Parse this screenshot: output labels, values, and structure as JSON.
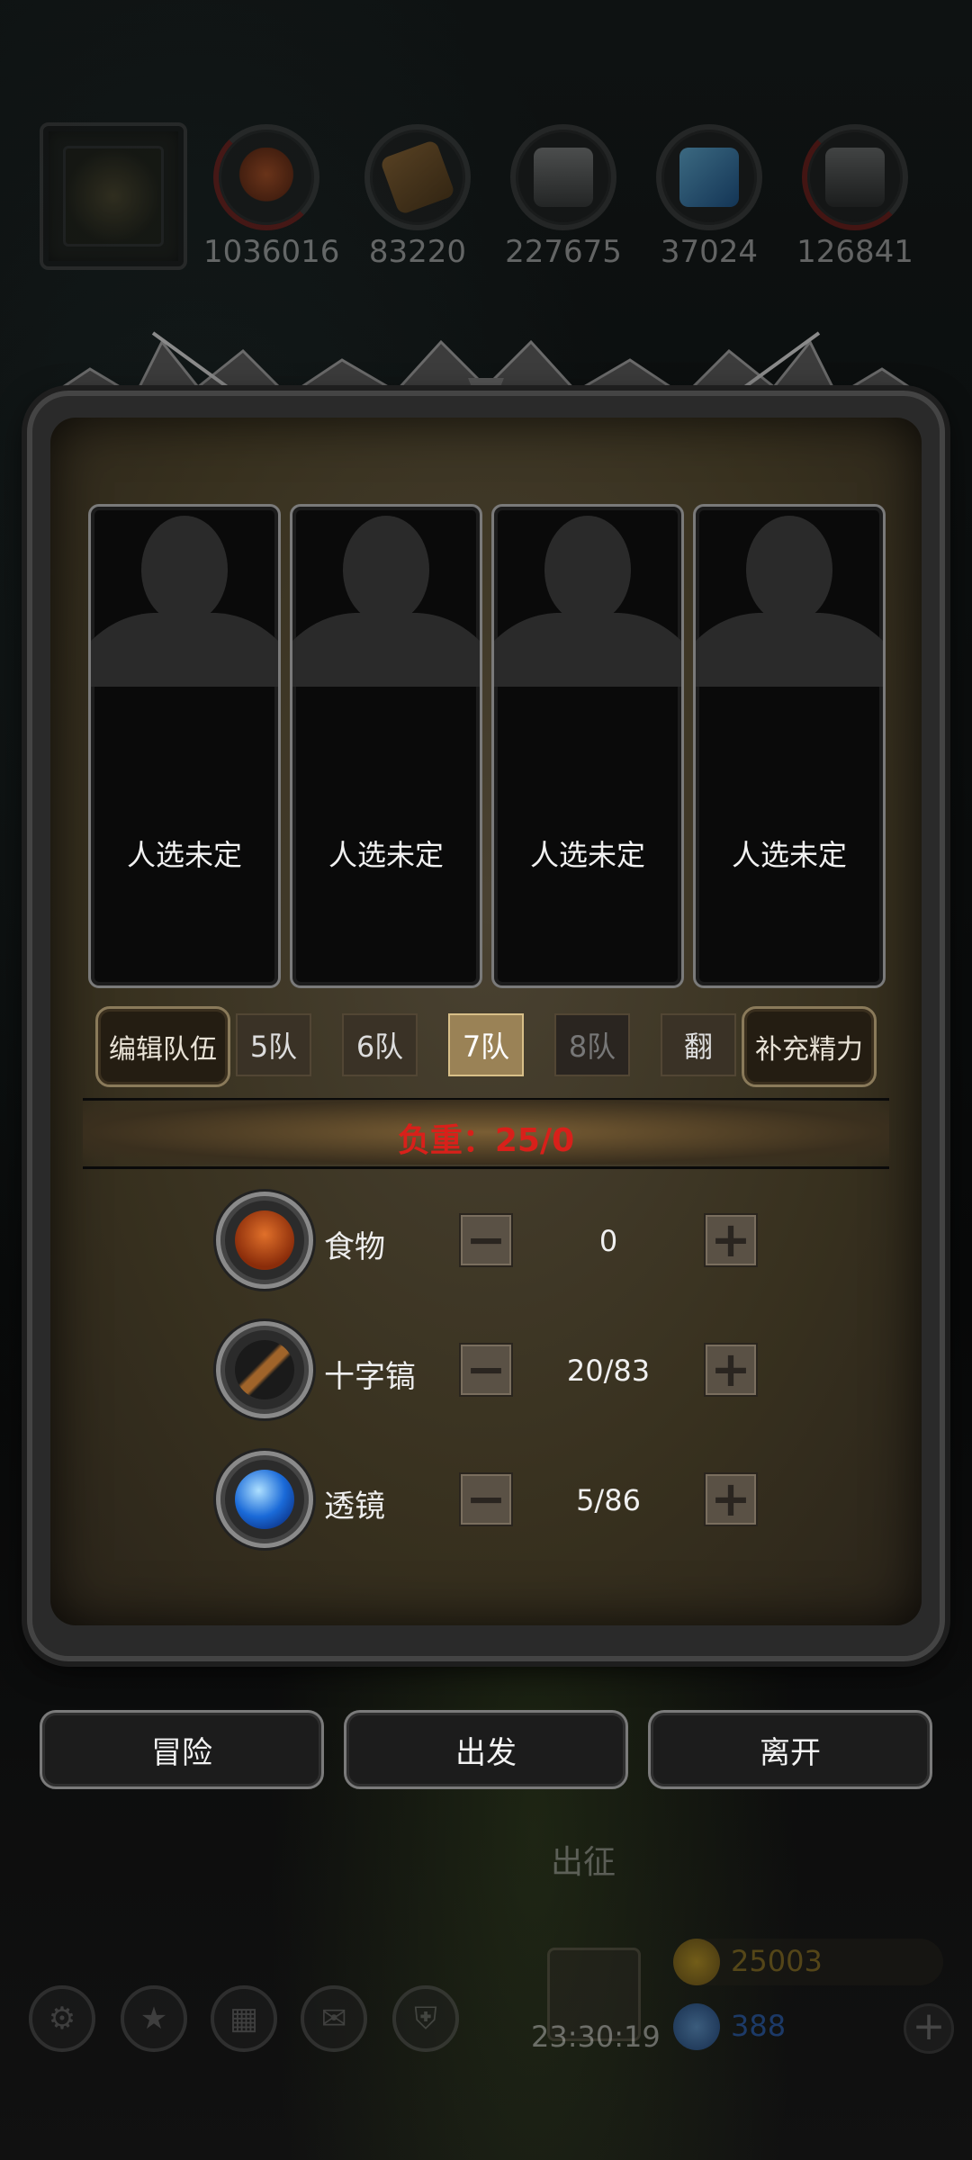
{
  "resources": [
    {
      "name": "food-icon",
      "value": "1036016"
    },
    {
      "name": "wood-icon",
      "value": "83220"
    },
    {
      "name": "iron-icon",
      "value": "227675"
    },
    {
      "name": "crystal-icon",
      "value": "37024"
    },
    {
      "name": "steel-icon",
      "value": "126841"
    }
  ],
  "slots": [
    {
      "label": "人选未定"
    },
    {
      "label": "人选未定"
    },
    {
      "label": "人选未定"
    },
    {
      "label": "人选未定"
    }
  ],
  "team_row": {
    "edit_label": "编辑队伍",
    "teams": [
      "5队",
      "6队",
      "7队",
      "8队"
    ],
    "active_team": "7队",
    "flip_label": "翻",
    "refill_label": "补充精力"
  },
  "weight_label": "负重：25/0",
  "supplies": [
    {
      "name": "食物",
      "icon": "food-icon",
      "qty": "0"
    },
    {
      "name": "十字镐",
      "icon": "pickaxe-icon",
      "qty": "20/83"
    },
    {
      "name": "透镜",
      "icon": "lens-icon",
      "qty": "5/86"
    }
  ],
  "actions": {
    "adventure": "冒险",
    "depart": "出发",
    "leave": "离开"
  },
  "hud": {
    "expedition_label": "出征",
    "timer": "23:30:19",
    "gold": "25003",
    "gems": "388"
  },
  "colors": {
    "weight_red": "#d8201a",
    "active_team": "#9a8256",
    "gold_text": "#a08020",
    "gem_text": "#2a6ad0"
  }
}
